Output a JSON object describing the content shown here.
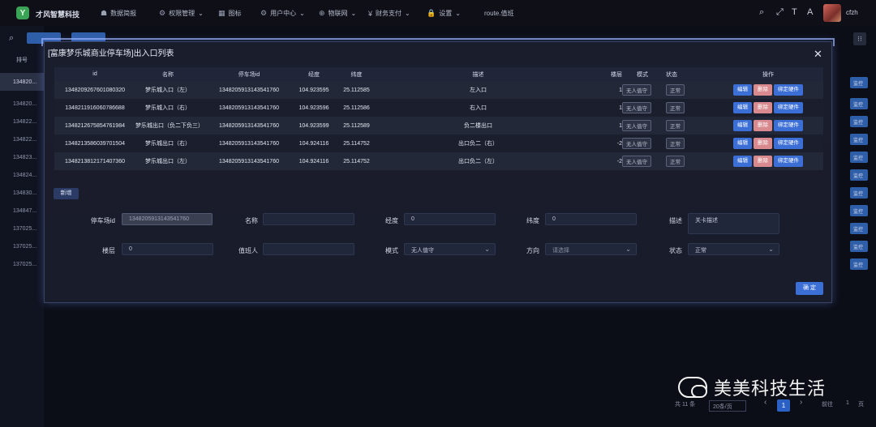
{
  "topbar": {
    "logo_text": "才风智慧科技",
    "nav": [
      {
        "icon": "☗",
        "label": "数据简报",
        "chevron": ""
      },
      {
        "icon": "⚙",
        "label": "权限管理",
        "chevron": "⌄"
      },
      {
        "icon": "▦",
        "label": "图标",
        "chevron": ""
      },
      {
        "icon": "⚙",
        "label": "用户中心",
        "chevron": "⌄"
      },
      {
        "icon": "⊕",
        "label": "物联网",
        "chevron": "⌄"
      },
      {
        "icon": "¥",
        "label": "财务支付",
        "chevron": "⌄"
      },
      {
        "icon": "🔒",
        "label": "设置",
        "chevron": "⌄"
      },
      {
        "icon": "",
        "label": "route.值班",
        "chevron": ""
      }
    ],
    "username": "cfzh"
  },
  "background": {
    "col_header": "排号",
    "rows": [
      "134820...",
      "134820...",
      "134822...",
      "134822...",
      "134823...",
      "134824...",
      "134830...",
      "134847...",
      "137025...",
      "137025...",
      "137025..."
    ],
    "right_btn": "监控",
    "pager": {
      "total": "共 11 条",
      "size": "20条/页",
      "current": "1",
      "goto": "前往",
      "goto_page": "1",
      "page_unit": "页",
      "prev": "‹",
      "next": "›"
    }
  },
  "modal": {
    "title": "[富康梦乐城商业停车场]出入口列表",
    "close": "✕",
    "columns": [
      "id",
      "名称",
      "停车场id",
      "经度",
      "纬度",
      "描述",
      "楼层",
      "模式",
      "状态",
      "操作"
    ],
    "rows": [
      {
        "id": "1348209267601080320",
        "name": "梦乐城入口（左）",
        "parking_id": "1348205913143541760",
        "lng": "104.923595",
        "lat": "25.112585",
        "desc": "左入口",
        "floor": "1",
        "mode": "无人值守",
        "status": "正常"
      },
      {
        "id": "1348211916060786688",
        "name": "梦乐城入口（右）",
        "parking_id": "1348205913143541760",
        "lng": "104.923596",
        "lat": "25.112586",
        "desc": "右入口",
        "floor": "1",
        "mode": "无人值守",
        "status": "正常"
      },
      {
        "id": "1348212675854761984",
        "name": "梦乐城出口（负二下负三）",
        "parking_id": "1348205913143541760",
        "lng": "104.923599",
        "lat": "25.112589",
        "desc": "负二楼出口",
        "floor": "1",
        "mode": "无人值守",
        "status": "正常"
      },
      {
        "id": "1348213586039701504",
        "name": "梦乐城出口（右）",
        "parking_id": "1348205913143541760",
        "lng": "104.924116",
        "lat": "25.114752",
        "desc": "出口负二（右）",
        "floor": "-2",
        "mode": "无人值守",
        "status": "正常"
      },
      {
        "id": "1348213812171407360",
        "name": "梦乐城出口（左）",
        "parking_id": "1348205913143541760",
        "lng": "104.924116",
        "lat": "25.114752",
        "desc": "出口负二（左）",
        "floor": "-2",
        "mode": "无人值守",
        "status": "正常"
      }
    ],
    "actions": {
      "edit": "编辑",
      "delete": "删除",
      "bind": "绑定硬件"
    },
    "add_button": "新增",
    "form": {
      "parking_id_label": "停车场id",
      "parking_id_value": "1348205913143541760",
      "name_label": "名称",
      "name_value": "",
      "lng_label": "经度",
      "lng_value": "0",
      "lat_label": "纬度",
      "lat_value": "0",
      "desc_label": "描述",
      "desc_placeholder": "关卡描述",
      "floor_label": "楼层",
      "floor_value": "0",
      "duty_label": "值班人",
      "duty_value": "",
      "mode_label": "模式",
      "mode_value": "无人值守",
      "direction_label": "方向",
      "direction_placeholder": "请选择",
      "status_label": "状态",
      "status_value": "正常"
    },
    "confirm_button": "确 定"
  },
  "watermark": "美美科技生活"
}
